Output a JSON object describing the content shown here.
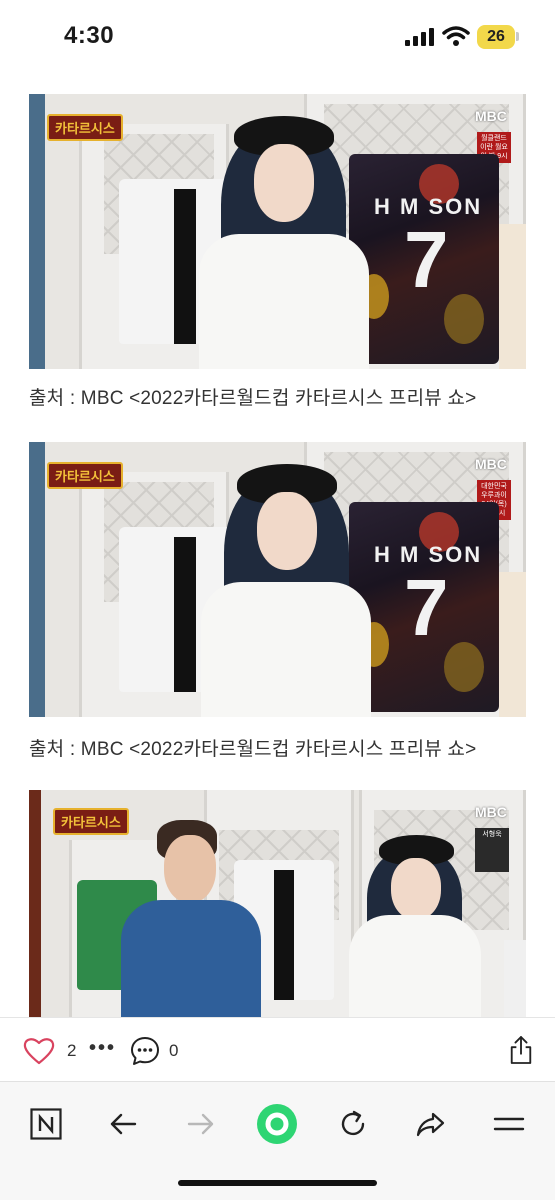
{
  "status_bar": {
    "time": "4:30",
    "battery": "26"
  },
  "post": {
    "images": [
      {
        "show_logo": "카타르시스",
        "mbc_logo": "MBC",
        "side_info": "월클랜드 이란 월요일 밤 9시",
        "jersey_name": "H M SON",
        "jersey_number": "7"
      },
      {
        "show_logo": "카타르시스",
        "mbc_logo": "MBC",
        "side_info": "대한민국 우루과이 24일(목) 밤 10시",
        "jersey_name": "H M SON",
        "jersey_number": "7"
      },
      {
        "show_logo": "카타르시스",
        "mbc_logo": "MBC",
        "side_info": "서형욱"
      }
    ],
    "captions": [
      "출처 : MBC <2022카타르월드컵 카타르시스 프리뷰 쇼>",
      "출처 : MBC <2022카타르월드컵 카타르시스 프리뷰 쇼>"
    ]
  },
  "actions": {
    "like_count": "2",
    "more": "•••",
    "comment_count": "0"
  },
  "colors": {
    "accent_green": "#2ed573",
    "like_red": "#d9435f"
  },
  "nav": {
    "icons": [
      "naver-n-icon",
      "back-arrow-icon",
      "forward-arrow-icon",
      "green-dot-icon",
      "refresh-icon",
      "share-icon",
      "menu-icon"
    ]
  }
}
